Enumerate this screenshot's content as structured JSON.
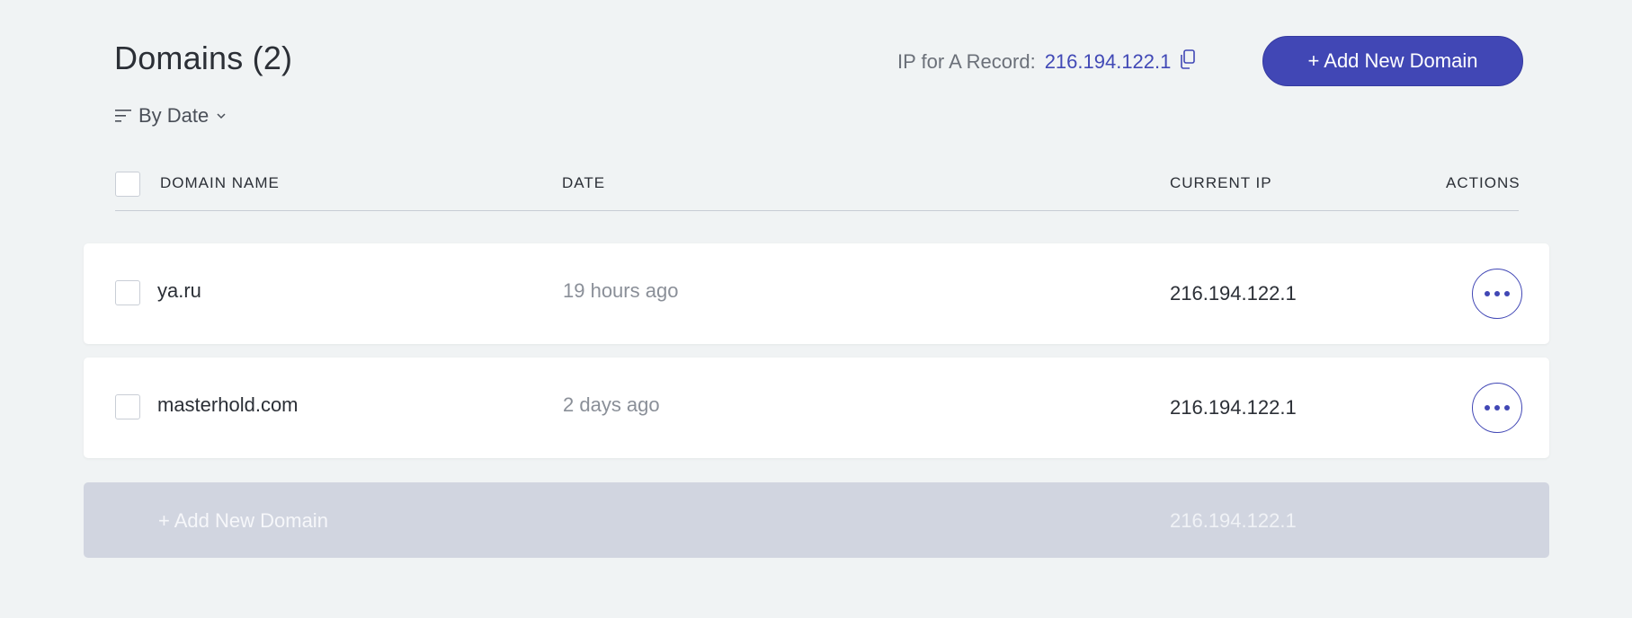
{
  "header": {
    "title": "Domains (2)",
    "sort_label": "By Date",
    "ip_record_label": "IP for A Record:",
    "ip_record_value": "216.194.122.1",
    "add_button_label": "+ Add New Domain"
  },
  "table": {
    "columns": [
      "DOMAIN NAME",
      "DATE",
      "CURRENT IP",
      "ACTIONS"
    ],
    "rows": [
      {
        "domain": "ya.ru",
        "date": "19 hours ago",
        "ip": "216.194.122.1"
      },
      {
        "domain": "masterhold.com",
        "date": "2 days ago",
        "ip": "216.194.122.1"
      }
    ],
    "add_row": {
      "label": "+ Add New Domain",
      "ip": "216.194.122.1"
    }
  },
  "icons": {
    "sort": "sort-lines-icon",
    "chevron": "chevron-down-icon",
    "copy": "copy-icon",
    "actions": "more-dots-icon"
  },
  "colors": {
    "background": "#f0f3f4",
    "accent": "#4147b5",
    "add_row_bg": "#d1d5e0"
  }
}
